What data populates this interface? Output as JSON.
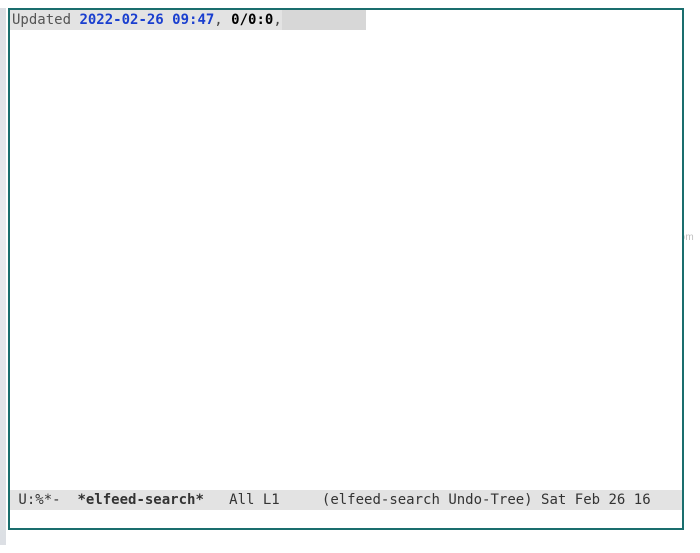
{
  "header": {
    "label": "Updated ",
    "date": "2022-02-26 09:47",
    "separator": ", ",
    "counts": "0/0:0",
    "trail": ","
  },
  "mode_line": {
    "prefix": " U:%*-  ",
    "buffer_name": "*elfeed-search*",
    "position": "   All L1     ",
    "modes": "(elfeed-search Undo-Tree) ",
    "datetime": "Sat Feb 26 16"
  },
  "watermark": "wsxdn.com"
}
